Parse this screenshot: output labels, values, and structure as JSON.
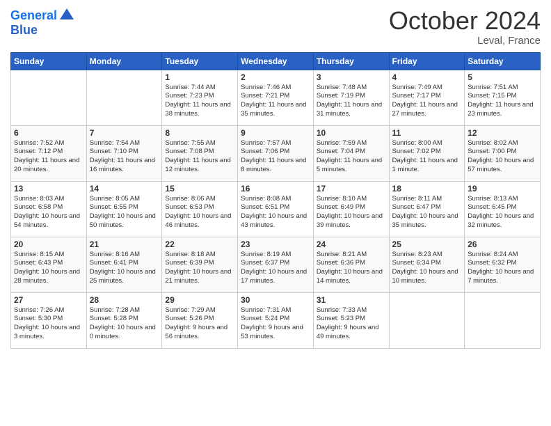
{
  "header": {
    "logo_general": "General",
    "logo_blue": "Blue",
    "month_title": "October 2024",
    "location": "Leval, France"
  },
  "days_of_week": [
    "Sunday",
    "Monday",
    "Tuesday",
    "Wednesday",
    "Thursday",
    "Friday",
    "Saturday"
  ],
  "weeks": [
    [
      {
        "day": "",
        "sunrise": "",
        "sunset": "",
        "daylight": "",
        "empty": true
      },
      {
        "day": "",
        "sunrise": "",
        "sunset": "",
        "daylight": "",
        "empty": true
      },
      {
        "day": "1",
        "sunrise": "Sunrise: 7:44 AM",
        "sunset": "Sunset: 7:23 PM",
        "daylight": "Daylight: 11 hours and 38 minutes."
      },
      {
        "day": "2",
        "sunrise": "Sunrise: 7:46 AM",
        "sunset": "Sunset: 7:21 PM",
        "daylight": "Daylight: 11 hours and 35 minutes."
      },
      {
        "day": "3",
        "sunrise": "Sunrise: 7:48 AM",
        "sunset": "Sunset: 7:19 PM",
        "daylight": "Daylight: 11 hours and 31 minutes."
      },
      {
        "day": "4",
        "sunrise": "Sunrise: 7:49 AM",
        "sunset": "Sunset: 7:17 PM",
        "daylight": "Daylight: 11 hours and 27 minutes."
      },
      {
        "day": "5",
        "sunrise": "Sunrise: 7:51 AM",
        "sunset": "Sunset: 7:15 PM",
        "daylight": "Daylight: 11 hours and 23 minutes."
      }
    ],
    [
      {
        "day": "6",
        "sunrise": "Sunrise: 7:52 AM",
        "sunset": "Sunset: 7:12 PM",
        "daylight": "Daylight: 11 hours and 20 minutes."
      },
      {
        "day": "7",
        "sunrise": "Sunrise: 7:54 AM",
        "sunset": "Sunset: 7:10 PM",
        "daylight": "Daylight: 11 hours and 16 minutes."
      },
      {
        "day": "8",
        "sunrise": "Sunrise: 7:55 AM",
        "sunset": "Sunset: 7:08 PM",
        "daylight": "Daylight: 11 hours and 12 minutes."
      },
      {
        "day": "9",
        "sunrise": "Sunrise: 7:57 AM",
        "sunset": "Sunset: 7:06 PM",
        "daylight": "Daylight: 11 hours and 8 minutes."
      },
      {
        "day": "10",
        "sunrise": "Sunrise: 7:59 AM",
        "sunset": "Sunset: 7:04 PM",
        "daylight": "Daylight: 11 hours and 5 minutes."
      },
      {
        "day": "11",
        "sunrise": "Sunrise: 8:00 AM",
        "sunset": "Sunset: 7:02 PM",
        "daylight": "Daylight: 11 hours and 1 minute."
      },
      {
        "day": "12",
        "sunrise": "Sunrise: 8:02 AM",
        "sunset": "Sunset: 7:00 PM",
        "daylight": "Daylight: 10 hours and 57 minutes."
      }
    ],
    [
      {
        "day": "13",
        "sunrise": "Sunrise: 8:03 AM",
        "sunset": "Sunset: 6:58 PM",
        "daylight": "Daylight: 10 hours and 54 minutes."
      },
      {
        "day": "14",
        "sunrise": "Sunrise: 8:05 AM",
        "sunset": "Sunset: 6:55 PM",
        "daylight": "Daylight: 10 hours and 50 minutes."
      },
      {
        "day": "15",
        "sunrise": "Sunrise: 8:06 AM",
        "sunset": "Sunset: 6:53 PM",
        "daylight": "Daylight: 10 hours and 46 minutes."
      },
      {
        "day": "16",
        "sunrise": "Sunrise: 8:08 AM",
        "sunset": "Sunset: 6:51 PM",
        "daylight": "Daylight: 10 hours and 43 minutes."
      },
      {
        "day": "17",
        "sunrise": "Sunrise: 8:10 AM",
        "sunset": "Sunset: 6:49 PM",
        "daylight": "Daylight: 10 hours and 39 minutes."
      },
      {
        "day": "18",
        "sunrise": "Sunrise: 8:11 AM",
        "sunset": "Sunset: 6:47 PM",
        "daylight": "Daylight: 10 hours and 35 minutes."
      },
      {
        "day": "19",
        "sunrise": "Sunrise: 8:13 AM",
        "sunset": "Sunset: 6:45 PM",
        "daylight": "Daylight: 10 hours and 32 minutes."
      }
    ],
    [
      {
        "day": "20",
        "sunrise": "Sunrise: 8:15 AM",
        "sunset": "Sunset: 6:43 PM",
        "daylight": "Daylight: 10 hours and 28 minutes."
      },
      {
        "day": "21",
        "sunrise": "Sunrise: 8:16 AM",
        "sunset": "Sunset: 6:41 PM",
        "daylight": "Daylight: 10 hours and 25 minutes."
      },
      {
        "day": "22",
        "sunrise": "Sunrise: 8:18 AM",
        "sunset": "Sunset: 6:39 PM",
        "daylight": "Daylight: 10 hours and 21 minutes."
      },
      {
        "day": "23",
        "sunrise": "Sunrise: 8:19 AM",
        "sunset": "Sunset: 6:37 PM",
        "daylight": "Daylight: 10 hours and 17 minutes."
      },
      {
        "day": "24",
        "sunrise": "Sunrise: 8:21 AM",
        "sunset": "Sunset: 6:36 PM",
        "daylight": "Daylight: 10 hours and 14 minutes."
      },
      {
        "day": "25",
        "sunrise": "Sunrise: 8:23 AM",
        "sunset": "Sunset: 6:34 PM",
        "daylight": "Daylight: 10 hours and 10 minutes."
      },
      {
        "day": "26",
        "sunrise": "Sunrise: 8:24 AM",
        "sunset": "Sunset: 6:32 PM",
        "daylight": "Daylight: 10 hours and 7 minutes."
      }
    ],
    [
      {
        "day": "27",
        "sunrise": "Sunrise: 7:26 AM",
        "sunset": "Sunset: 5:30 PM",
        "daylight": "Daylight: 10 hours and 3 minutes."
      },
      {
        "day": "28",
        "sunrise": "Sunrise: 7:28 AM",
        "sunset": "Sunset: 5:28 PM",
        "daylight": "Daylight: 10 hours and 0 minutes."
      },
      {
        "day": "29",
        "sunrise": "Sunrise: 7:29 AM",
        "sunset": "Sunset: 5:26 PM",
        "daylight": "Daylight: 9 hours and 56 minutes."
      },
      {
        "day": "30",
        "sunrise": "Sunrise: 7:31 AM",
        "sunset": "Sunset: 5:24 PM",
        "daylight": "Daylight: 9 hours and 53 minutes."
      },
      {
        "day": "31",
        "sunrise": "Sunrise: 7:33 AM",
        "sunset": "Sunset: 5:23 PM",
        "daylight": "Daylight: 9 hours and 49 minutes."
      },
      {
        "day": "",
        "sunrise": "",
        "sunset": "",
        "daylight": "",
        "empty": true
      },
      {
        "day": "",
        "sunrise": "",
        "sunset": "",
        "daylight": "",
        "empty": true
      }
    ]
  ]
}
